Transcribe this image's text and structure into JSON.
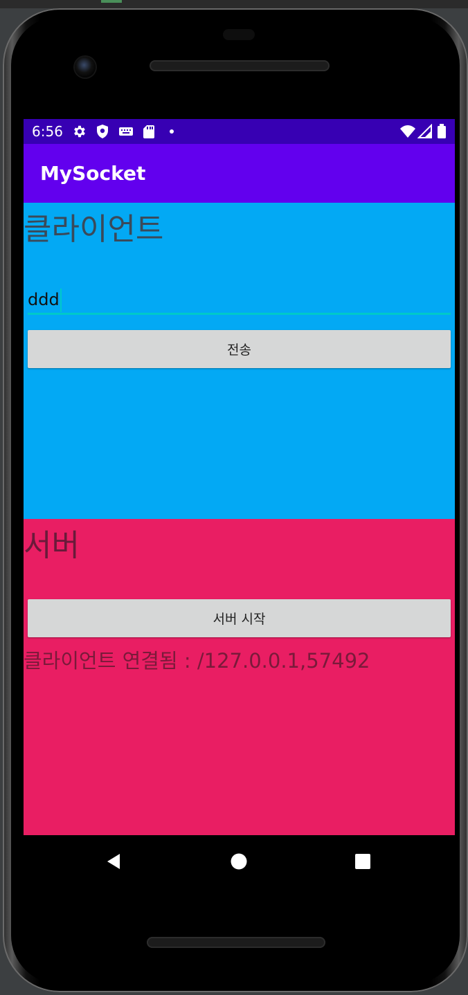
{
  "status_bar": {
    "time": "6:56",
    "icons": [
      "gear-icon",
      "shield-icon",
      "keyboard-icon",
      "sd-card-icon",
      "dot-icon",
      "wifi-icon",
      "signal-icon",
      "battery-icon"
    ]
  },
  "app_bar": {
    "title": "MySocket"
  },
  "client": {
    "title": "클라이언트",
    "input_value": "ddd",
    "send_button": "전송",
    "background": "#03a9f4"
  },
  "server": {
    "title": "서버",
    "start_button": "서버 시작",
    "status": "클라이언트 연결됨 : /127.0.0.1,57492",
    "background": "#e91e63"
  },
  "nav_bar": {
    "buttons": [
      "back-icon",
      "home-icon",
      "recents-icon"
    ]
  },
  "colors": {
    "status_bar": "#3700b3",
    "app_bar": "#6200ee",
    "accent": "#00c9c9"
  }
}
